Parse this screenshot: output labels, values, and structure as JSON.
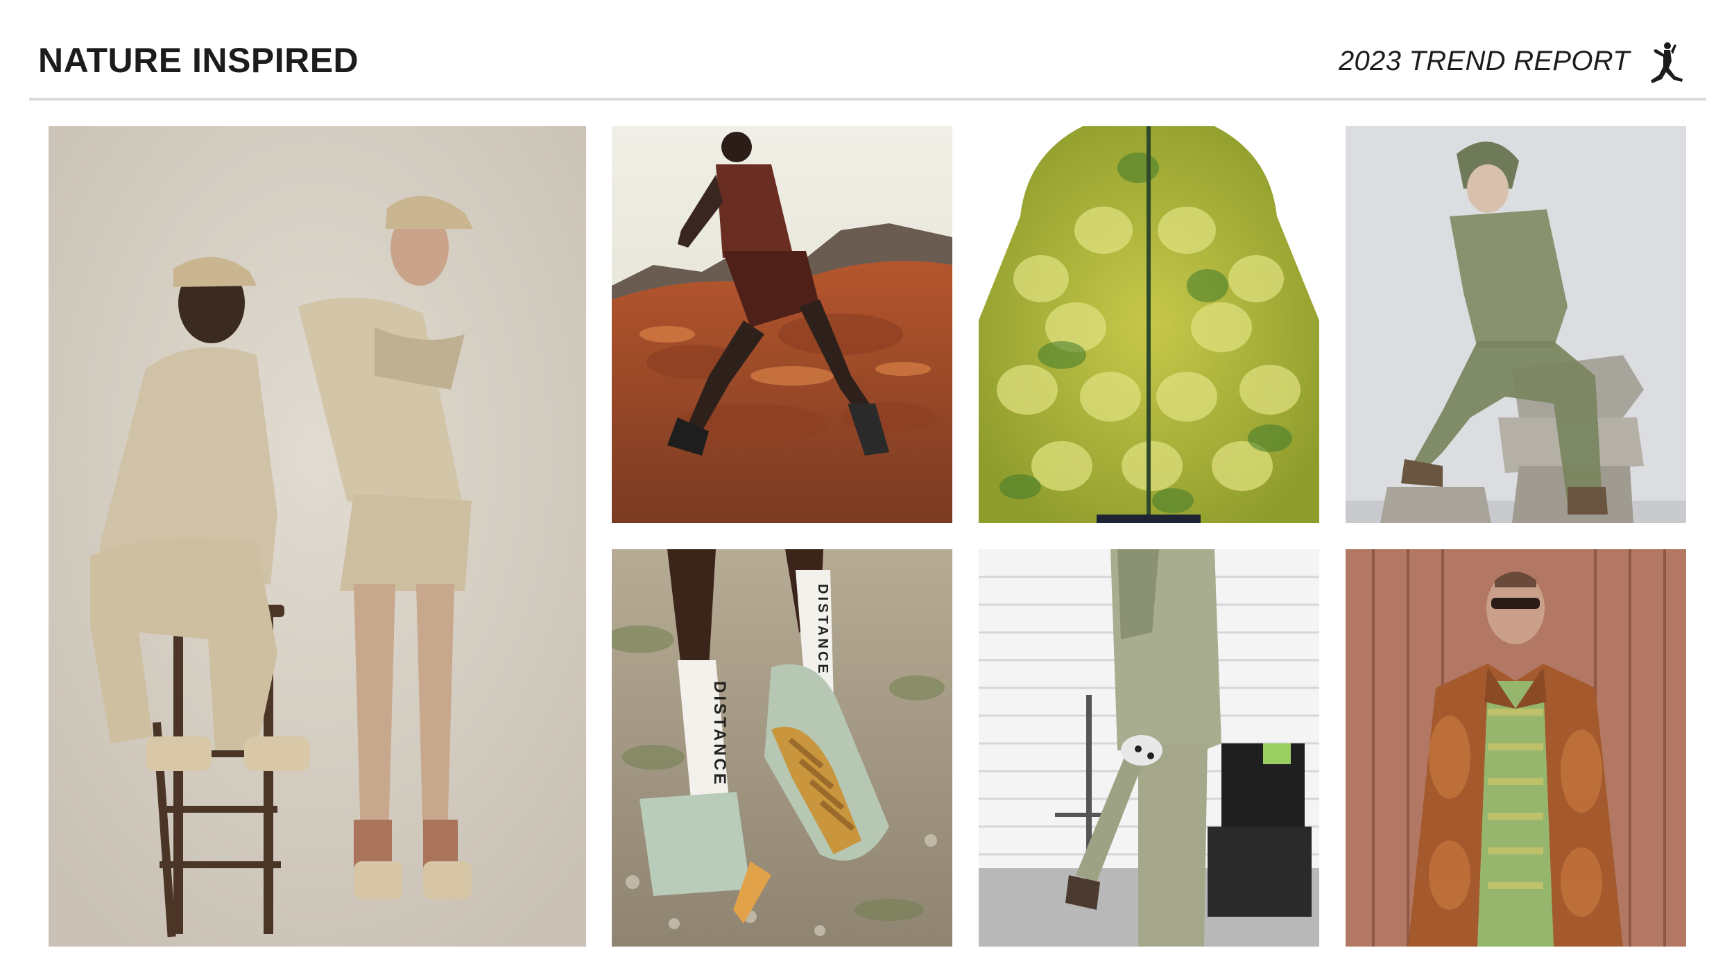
{
  "header": {
    "title": "NATURE INSPIRED",
    "report_label": "2023 TREND REPORT",
    "logo": "jumpman-logo"
  },
  "photos": [
    {
      "id": "photo-couple-neutral-sweats",
      "sock_text": ""
    },
    {
      "id": "photo-runner-red-rocks",
      "sock_text": ""
    },
    {
      "id": "photo-green-tie-dye-puffer",
      "sock_text": ""
    },
    {
      "id": "photo-sheer-green-jumpsuit",
      "sock_text": ""
    },
    {
      "id": "photo-distance-socks-trail-shoes",
      "sock_text": "DISTANCE"
    },
    {
      "id": "photo-dirty-wash-suit",
      "sock_text": ""
    },
    {
      "id": "photo-rust-suede-jacket",
      "sock_text": ""
    }
  ],
  "colors": {
    "title": "#1c1c1c",
    "divider": "#d9d9d9",
    "background": "#ffffff"
  }
}
